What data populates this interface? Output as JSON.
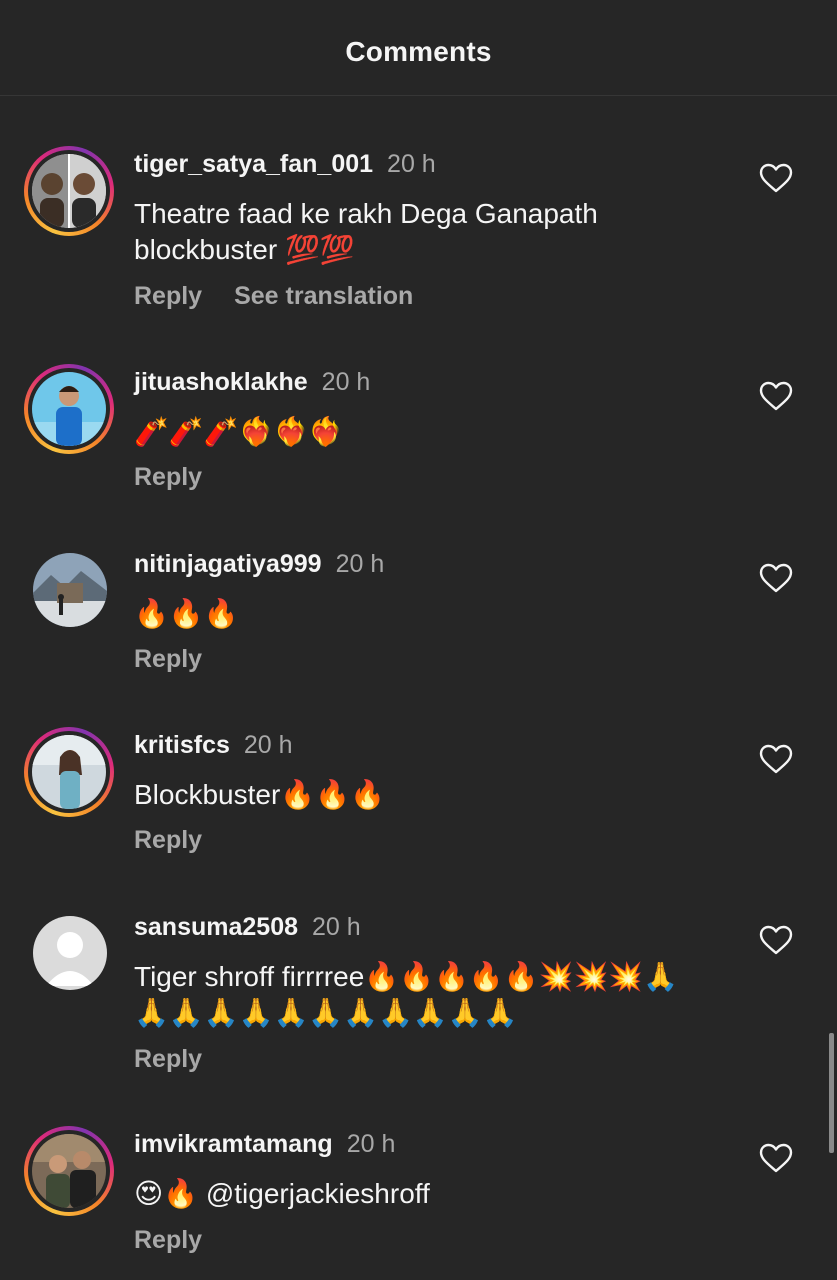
{
  "header": {
    "title": "Comments"
  },
  "actions": {
    "reply": "Reply",
    "see_translation": "See translation"
  },
  "comments": [
    {
      "username": "tiger_satya_fan_001",
      "time": "20 h",
      "text_line1": "Theatre faad ke rakh Dega Ganapath",
      "text_line2": "blockbuster 💯💯",
      "has_story_ring": true
    },
    {
      "username": "jituashoklakhe",
      "time": "20 h",
      "text": "🧨🧨🧨❤️‍🔥❤️‍🔥❤️‍🔥",
      "has_story_ring": true
    },
    {
      "username": "nitinjagatiya999",
      "time": "20 h",
      "text": "🔥🔥🔥",
      "has_story_ring": false
    },
    {
      "username": "kritisfcs",
      "time": "20 h",
      "text": "Blockbuster🔥🔥🔥",
      "has_story_ring": true
    },
    {
      "username": "sansuma2508",
      "time": "20 h",
      "text_line1": "Tiger shroff firrrree🔥🔥🔥🔥🔥💥💥💥🙏",
      "text_line2": "🙏🙏🙏🙏🙏🙏🙏🙏🙏🙏🙏",
      "has_story_ring": false
    },
    {
      "username": "imvikramtamang",
      "time": "20 h",
      "text": "😍🔥 @tigerjackieshroff",
      "has_story_ring": true
    }
  ],
  "colors": {
    "background": "#262626",
    "secondary_text": "#a8a8a8",
    "primary_text": "#f5f5f5"
  },
  "icons": {
    "like": "heart-outline-icon"
  }
}
